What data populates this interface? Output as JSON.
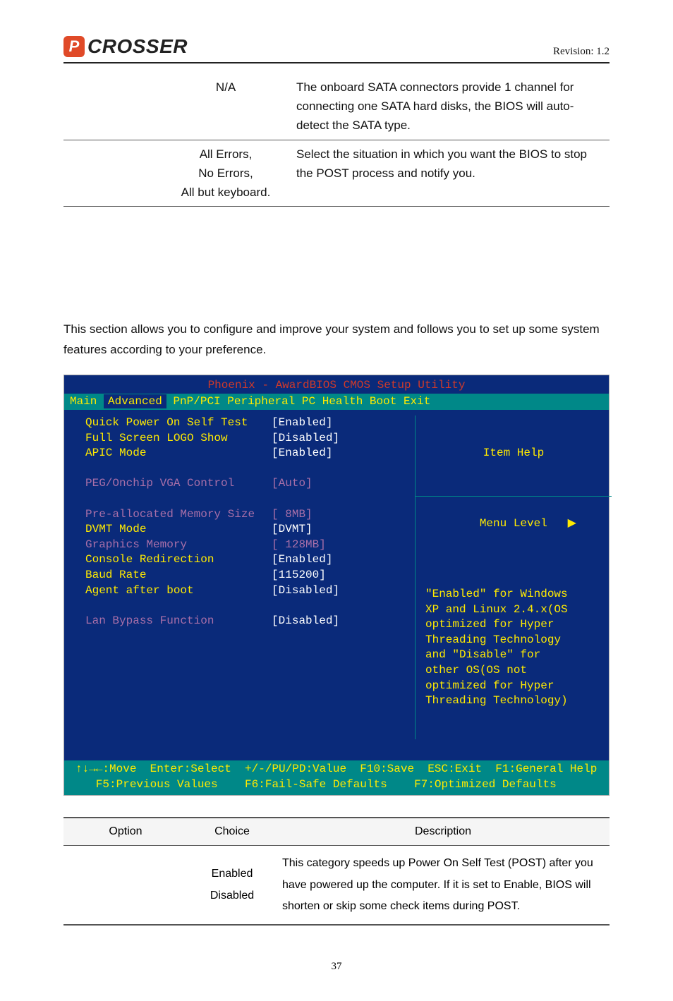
{
  "header": {
    "logo_mark": "P",
    "logo_text": "CROSSER",
    "revision": "Revision: 1.2"
  },
  "table1": {
    "rows": [
      {
        "option": "",
        "choice": "N/A",
        "desc": "The onboard SATA connectors provide 1 channel for connecting one SATA hard disks, the BIOS will auto-detect the SATA type."
      },
      {
        "option": "",
        "choice": "All Errors,\nNo Errors,\nAll but keyboard.",
        "desc": "Select the situation in which you want the BIOS to stop the POST process and notify you."
      }
    ]
  },
  "intro": "This section allows you to configure and improve your system and follows you to set up some system features according to your preference.",
  "bios": {
    "title": "Phoenix - AwardBIOS CMOS Setup Utility",
    "tabs": [
      "Main",
      "Advanced",
      "PnP/PCI",
      "Peripheral",
      "PC Health",
      "Boot",
      "Exit"
    ],
    "selected_tab_index": 1,
    "left_labels": "Quick Power On Self Test\nFull Screen LOGO Show\nAPIC Mode\n\nPEG/Onchip VGA Control\n\nPre-allocated Memory Size\nDVMT Mode\nGraphics Memory\nConsole Redirection\nBaud Rate\nAgent after boot\n\nLan Bypass Function",
    "left_values": "[Enabled]\n[Disabled]\n[Enabled]\n\n[Auto]\n\n[ 8MB]\n[DVMT]\n[ 128MB]\n[Enabled]\n[115200]\n[Disabled]\n\n[Disabled]",
    "purple_label_indices": [
      4,
      6,
      8,
      13
    ],
    "purple_value_indices": [
      4,
      6,
      8
    ],
    "item_help_title": "Item Help",
    "menu_level": "Menu Level   ▶",
    "help_body": "\"Enabled\" for Windows\nXP and Linux 2.4.x(OS\noptimized for Hyper\nThreading Technology\nand \"Disable\" for\nother OS(OS not\noptimized for Hyper\nThreading Technology)",
    "footer": "↑↓→←:Move  Enter:Select  +/-/PU/PD:Value  F10:Save  ESC:Exit  F1:General Help\n   F5:Previous Values    F6:Fail-Safe Defaults    F7:Optimized Defaults"
  },
  "table2": {
    "headers": {
      "option": "Option",
      "choice": "Choice",
      "desc": "Description"
    },
    "rows": [
      {
        "option": "",
        "choice": "Enabled\nDisabled",
        "desc": "This category speeds up Power On Self Test (POST) after you have powered up the computer. If it is set to Enable, BIOS will shorten or skip some check items during POST."
      }
    ]
  },
  "page_number": "37"
}
